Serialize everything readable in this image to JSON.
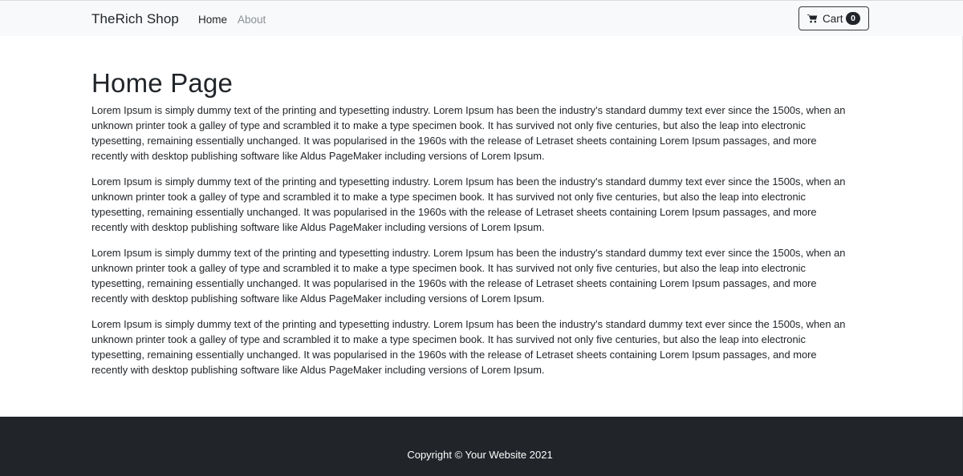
{
  "navbar": {
    "brand": "TheRich Shop",
    "links": [
      {
        "label": "Home",
        "active": true
      },
      {
        "label": "About",
        "active": false
      }
    ],
    "cart": {
      "label": "Cart",
      "count": "0",
      "icon": "cart-icon"
    }
  },
  "main": {
    "title": "Home Page",
    "paragraphs": [
      "Lorem Ipsum is simply dummy text of the printing and typesetting industry. Lorem Ipsum has been the industry's standard dummy text ever since the 1500s, when an unknown printer took a galley of type and scrambled it to make a type specimen book. It has survived not only five centuries, but also the leap into electronic typesetting, remaining essentially unchanged. It was popularised in the 1960s with the release of Letraset sheets containing Lorem Ipsum passages, and more recently with desktop publishing software like Aldus PageMaker including versions of Lorem Ipsum.",
      "Lorem Ipsum is simply dummy text of the printing and typesetting industry. Lorem Ipsum has been the industry's standard dummy text ever since the 1500s, when an unknown printer took a galley of type and scrambled it to make a type specimen book. It has survived not only five centuries, but also the leap into electronic typesetting, remaining essentially unchanged. It was popularised in the 1960s with the release of Letraset sheets containing Lorem Ipsum passages, and more recently with desktop publishing software like Aldus PageMaker including versions of Lorem Ipsum.",
      "Lorem Ipsum is simply dummy text of the printing and typesetting industry. Lorem Ipsum has been the industry's standard dummy text ever since the 1500s, when an unknown printer took a galley of type and scrambled it to make a type specimen book. It has survived not only five centuries, but also the leap into electronic typesetting, remaining essentially unchanged. It was popularised in the 1960s with the release of Letraset sheets containing Lorem Ipsum passages, and more recently with desktop publishing software like Aldus PageMaker including versions of Lorem Ipsum.",
      "Lorem Ipsum is simply dummy text of the printing and typesetting industry. Lorem Ipsum has been the industry's standard dummy text ever since the 1500s, when an unknown printer took a galley of type and scrambled it to make a type specimen book. It has survived not only five centuries, but also the leap into electronic typesetting, remaining essentially unchanged. It was popularised in the 1960s with the release of Letraset sheets containing Lorem Ipsum passages, and more recently with desktop publishing software like Aldus PageMaker including versions of Lorem Ipsum."
    ]
  },
  "footer": {
    "copyright": "Copyright © Your Website 2021"
  },
  "colors": {
    "navbar_bg": "#f8f9fa",
    "footer_bg": "#212529",
    "text": "#212529",
    "muted_link": "#8a8f94",
    "badge_bg": "#212529"
  }
}
